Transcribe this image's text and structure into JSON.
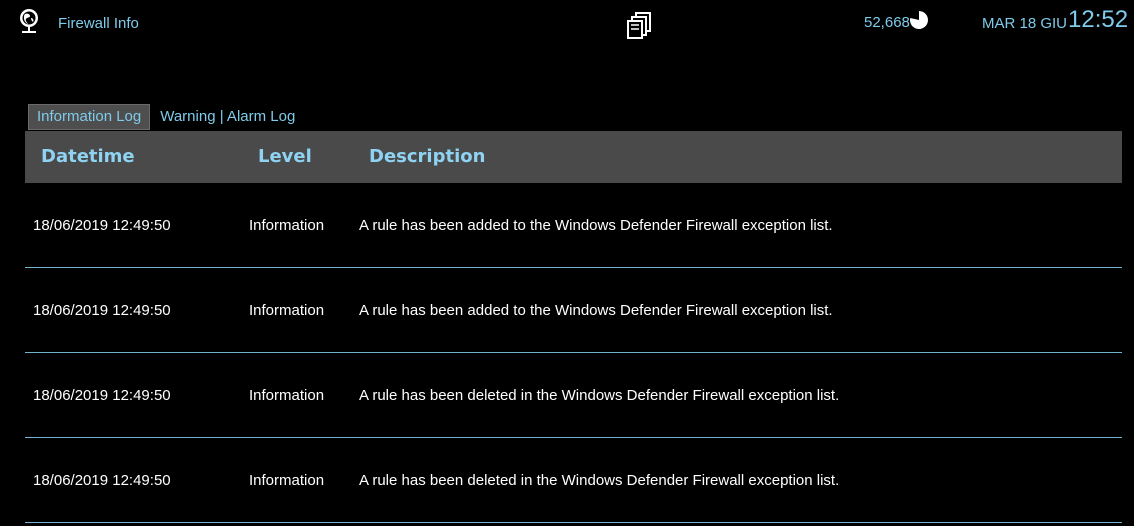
{
  "header": {
    "app_title": "Firewall Info",
    "counter": "52,668",
    "date": "MAR 18 GIU",
    "time": "12:52"
  },
  "icons": {
    "app": "globe-network-icon",
    "copy": "copy-pages-icon",
    "pie": "pie-chart-icon"
  },
  "tabs": [
    {
      "label": "Information Log",
      "active": true
    },
    {
      "label": "Warning | Alarm Log",
      "active": false
    }
  ],
  "table": {
    "columns": [
      "Datetime",
      "Level",
      "Description"
    ],
    "rows": [
      {
        "datetime": "18/06/2019 12:49:50",
        "level": "Information",
        "description": "A rule has been added to the Windows Defender Firewall exception list."
      },
      {
        "datetime": "18/06/2019 12:49:50",
        "level": "Information",
        "description": "A rule has been added to the Windows Defender Firewall exception list."
      },
      {
        "datetime": "18/06/2019 12:49:50",
        "level": "Information",
        "description": "A rule has been deleted in the Windows Defender Firewall exception list."
      },
      {
        "datetime": "18/06/2019 12:49:50",
        "level": "Information",
        "description": "A rule has been deleted in the Windows Defender Firewall exception list."
      }
    ]
  },
  "colors": {
    "background": "#000000",
    "accent_text": "#7ecbea",
    "header_bg": "#4a4a4a",
    "row_divider": "#6fb3cf",
    "cell_text": "#ffffff"
  }
}
